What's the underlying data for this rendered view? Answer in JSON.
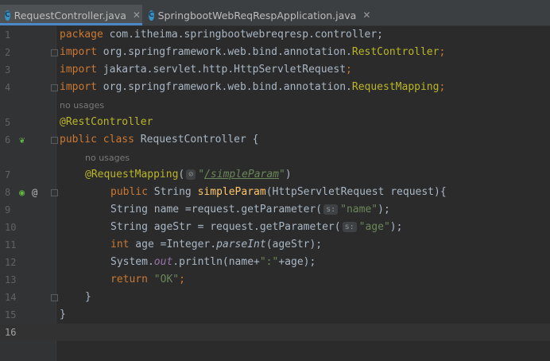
{
  "tabs": [
    {
      "label": "RequestController.java",
      "icon": "c-class-icon",
      "close": "✕",
      "active": true
    },
    {
      "label": "SpringbootWebReqRespApplication.java",
      "icon": "c-class-icon",
      "close": "✕",
      "active": false
    }
  ],
  "editor": {
    "hint_no_usages": "no usages",
    "param_hint_s": "s:",
    "lines": {
      "l1": {
        "num": "1",
        "kw": "package",
        "rest": " com.itheima.springbootwebreqresp.controller;"
      },
      "l2": {
        "num": "2",
        "kw": "import",
        "pkg": " org.springframework.web.bind.annotation.",
        "cls": "RestController",
        "semi": ";"
      },
      "l3": {
        "num": "3",
        "kw": "import",
        "pkg": " jakarta.servlet.http.HttpServletRequest",
        "semi": ";"
      },
      "l4": {
        "num": "4",
        "kw": "import",
        "pkg": " org.springframework.web.bind.annotation.",
        "cls": "RequestMapping",
        "semi": ";"
      },
      "l5": {
        "num": "5",
        "an": "@RestController"
      },
      "l6": {
        "num": "6",
        "kw": "public class",
        "rest": " RequestController {"
      },
      "l7": {
        "num": "7",
        "an": "@RequestMapping",
        "open": "(",
        "icon_glyph": "⊘",
        "q1": "\"",
        "path": "/simpleParam",
        "q2": "\"",
        "close": ")"
      },
      "l8": {
        "num": "8",
        "kw": "public",
        "type": " String ",
        "fn": "simpleParam",
        "rest": "(HttpServletRequest request){"
      },
      "l9": {
        "num": "9",
        "pre": "String name =request.getParameter(",
        "str": "\"name\"",
        "post": ");"
      },
      "l10": {
        "num": "10",
        "pre": "String ageStr = request.getParameter(",
        "str": "\"age\"",
        "post": ");"
      },
      "l11": {
        "num": "11",
        "kw": "int",
        "mid": " age =Integer.",
        "it": "parseInt",
        "post": "(ageStr);"
      },
      "l12": {
        "num": "12",
        "pre": "System.",
        "fld": "out",
        "mid": ".println(name+",
        "str": "\":\"",
        "post": "+age);"
      },
      "l13": {
        "num": "13",
        "kw": "return",
        "sp": " ",
        "str": "\"OK\"",
        "post": ";"
      },
      "l14": {
        "num": "14",
        "code": "}"
      },
      "l15": {
        "num": "15",
        "code": "}"
      },
      "l16": {
        "num": "16",
        "code": ""
      }
    }
  },
  "gutter": {
    "bean_glyph": "❦",
    "web_glyph": "◉",
    "at_glyph": "@"
  },
  "colors": {
    "keyword": "#cc7832",
    "annotation": "#bbb529",
    "string": "#6a8759",
    "method": "#ffc66d",
    "field": "#9876aa",
    "text": "#a9b7c6"
  }
}
